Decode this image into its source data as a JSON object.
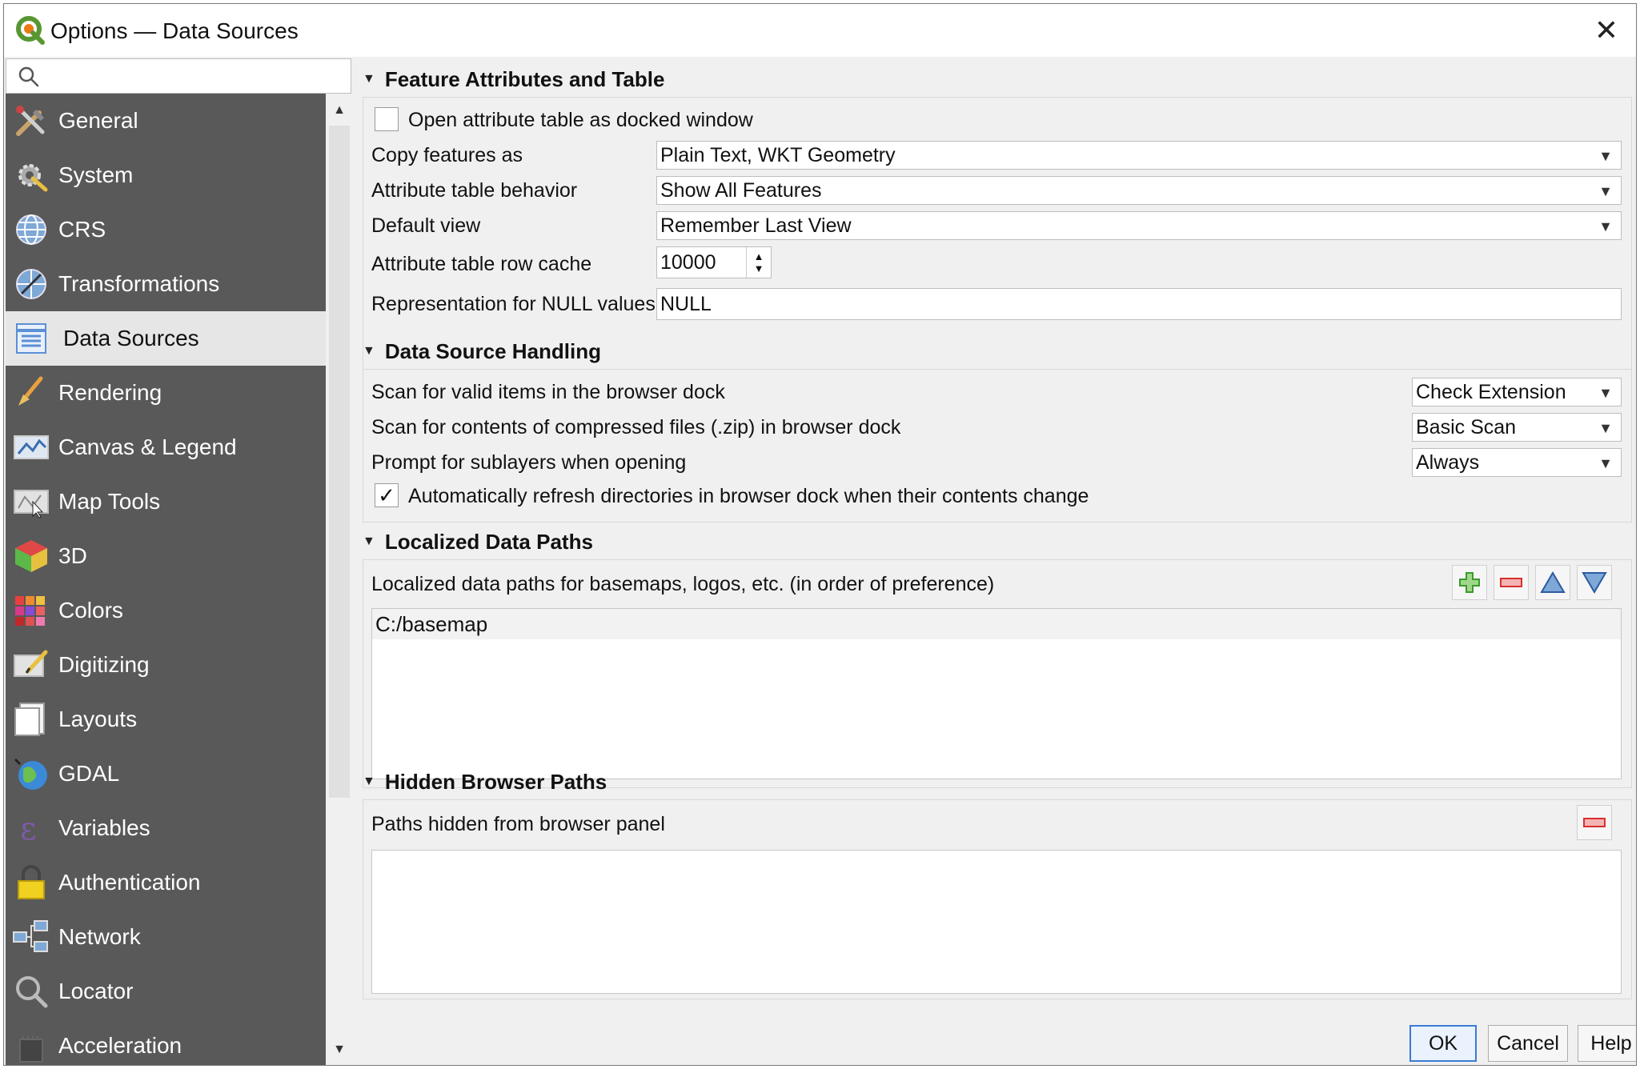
{
  "window": {
    "title": "Options — Data Sources",
    "close": "✕"
  },
  "search": {
    "placeholder": ""
  },
  "sidebar": {
    "items": [
      {
        "label": "General",
        "icon": "tools-icon"
      },
      {
        "label": "System",
        "icon": "system-icon"
      },
      {
        "label": "CRS",
        "icon": "globe-icon"
      },
      {
        "label": "Transformations",
        "icon": "transform-icon"
      },
      {
        "label": "Data Sources",
        "icon": "table-icon",
        "active": true
      },
      {
        "label": "Rendering",
        "icon": "brush-icon"
      },
      {
        "label": "Canvas & Legend",
        "icon": "canvas-icon"
      },
      {
        "label": "Map Tools",
        "icon": "map-tools-icon"
      },
      {
        "label": "3D",
        "icon": "cube-icon"
      },
      {
        "label": "Colors",
        "icon": "palette-icon"
      },
      {
        "label": "Digitizing",
        "icon": "digitizing-icon"
      },
      {
        "label": "Layouts",
        "icon": "layouts-icon"
      },
      {
        "label": "GDAL",
        "icon": "gdal-icon"
      },
      {
        "label": "Variables",
        "icon": "variables-icon"
      },
      {
        "label": "Authentication",
        "icon": "lock-icon"
      },
      {
        "label": "Network",
        "icon": "network-icon"
      },
      {
        "label": "Locator",
        "icon": "locator-icon"
      },
      {
        "label": "Acceleration",
        "icon": "chip-icon"
      }
    ]
  },
  "feature_attributes": {
    "title": "Feature Attributes and Table",
    "open_docked_label": "Open attribute table as docked window",
    "open_docked_checked": false,
    "copy_features_label": "Copy features as",
    "copy_features_value": "Plain Text, WKT Geometry",
    "behavior_label": "Attribute table behavior",
    "behavior_value": "Show All Features",
    "default_view_label": "Default view",
    "default_view_value": "Remember Last View",
    "row_cache_label": "Attribute table row cache",
    "row_cache_value": "10000",
    "null_label": "Representation for NULL values",
    "null_value": "NULL"
  },
  "data_source_handling": {
    "title": "Data Source Handling",
    "scan_label": "Scan for valid items in the browser dock",
    "scan_value": "Check Extension",
    "zip_label": "Scan for contents of compressed files (.zip) in browser dock",
    "zip_value": "Basic Scan",
    "sublayers_label": "Prompt for sublayers when opening",
    "sublayers_value": "Always",
    "refresh_label": "Automatically refresh directories in browser dock when their contents change",
    "refresh_checked": true,
    "check_mark": "✓"
  },
  "localized_paths": {
    "title": "Localized Data Paths",
    "description": "Localized data paths for basemaps, logos, etc. (in order of preference)",
    "paths": [
      "C:/basemap"
    ]
  },
  "hidden_paths": {
    "title": "Hidden Browser Paths",
    "description": "Paths hidden from browser panel",
    "paths": []
  },
  "buttons": {
    "ok": "OK",
    "cancel": "Cancel",
    "help": "Help"
  },
  "glyphs": {
    "collapse": "▼",
    "dropdown": "▼",
    "up": "▲",
    "down": "▼"
  }
}
